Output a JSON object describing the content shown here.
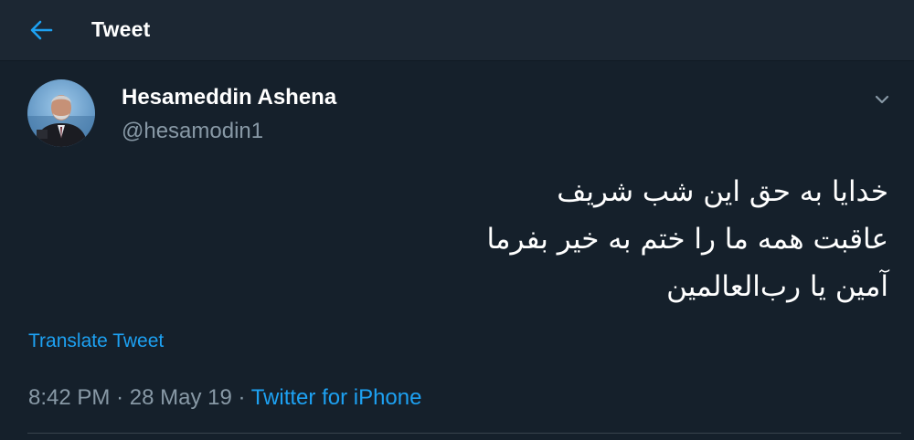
{
  "header": {
    "back_icon": "arrow-left-icon",
    "title": "Tweet"
  },
  "tweet": {
    "author_name": "Hesameddin Ashena",
    "author_handle": "@hesamodin1",
    "menu_icon": "chevron-down-icon",
    "avatar_icon": "avatar-photo",
    "lines": [
      "خدایا به حق این شب شریف",
      "عاقبت همه ما را ختم به خیر بفرما",
      "آمین یا رب‌العالمین"
    ],
    "translate_label": "Translate Tweet",
    "time": "8:42 PM",
    "separator": "·",
    "date": "28 May 19",
    "source": "Twitter for iPhone"
  },
  "colors": {
    "background": "#15202b",
    "header_background": "#1c2733",
    "accent": "#1da1f2",
    "secondary_text": "#8899a6",
    "divider": "#38444d"
  }
}
